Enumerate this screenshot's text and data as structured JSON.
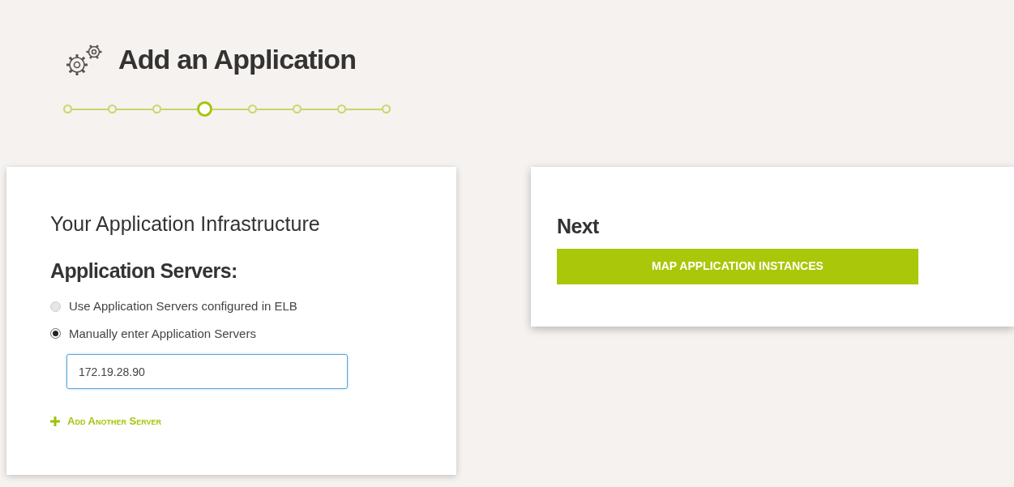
{
  "page": {
    "title": "Add an Application"
  },
  "steps": [
    {
      "selected": false
    },
    {
      "selected": false
    },
    {
      "selected": false
    },
    {
      "selected": true
    },
    {
      "selected": false
    },
    {
      "selected": false
    },
    {
      "selected": false
    },
    {
      "selected": false
    }
  ],
  "infrastructure": {
    "heading": "Your Application Infrastructure",
    "subheading": "Application Servers:",
    "options": [
      {
        "label": "Use Application Servers configured in ELB",
        "selected": false
      },
      {
        "label": "Manually enter Application Servers",
        "selected": true
      }
    ],
    "server_field": {
      "value": "172.19.28.90"
    },
    "add_link": "Add Another Server"
  },
  "next": {
    "heading": "Next",
    "button": "MAP APPLICATION INSTANCES"
  }
}
